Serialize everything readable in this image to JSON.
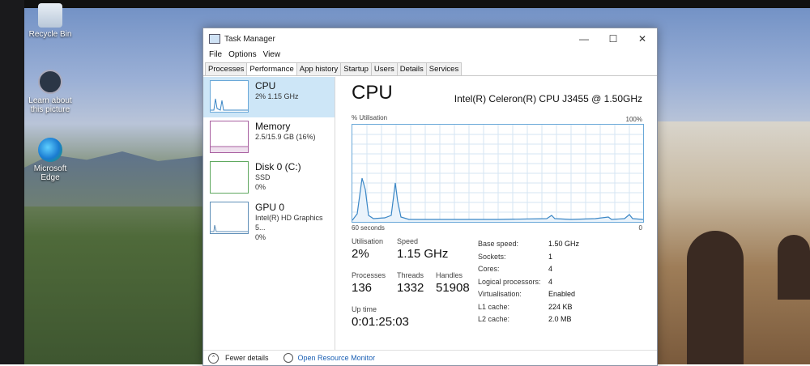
{
  "desktop": {
    "icons": [
      {
        "label": "Recycle Bin"
      },
      {
        "label": "Learn about this picture"
      },
      {
        "label": "Microsoft Edge"
      }
    ]
  },
  "window": {
    "title": "Task Manager",
    "menu": [
      "File",
      "Options",
      "View"
    ],
    "tabs": [
      "Processes",
      "Performance",
      "App history",
      "Startup",
      "Users",
      "Details",
      "Services"
    ],
    "active_tab": "Performance"
  },
  "sidebar": {
    "items": [
      {
        "name": "CPU",
        "sub": "2%  1.15 GHz",
        "sub2": ""
      },
      {
        "name": "Memory",
        "sub": "2.5/15.9 GB (16%)",
        "sub2": ""
      },
      {
        "name": "Disk 0 (C:)",
        "sub": "SSD",
        "sub2": "0%"
      },
      {
        "name": "GPU 0",
        "sub": "Intel(R) HD Graphics 5...",
        "sub2": "0%"
      }
    ]
  },
  "main": {
    "title": "CPU",
    "model": "Intel(R) Celeron(R) CPU J3455 @ 1.50GHz",
    "graph": {
      "y_label": "% Utilisation",
      "y_max_label": "100%",
      "x_left_label": "60 seconds",
      "x_right_label": "0"
    },
    "stats": {
      "utilisation_label": "Utilisation",
      "utilisation": "2%",
      "speed_label": "Speed",
      "speed": "1.15 GHz",
      "processes_label": "Processes",
      "processes": "136",
      "threads_label": "Threads",
      "threads": "1332",
      "handles_label": "Handles",
      "handles": "51908",
      "uptime_label": "Up time",
      "uptime": "0:01:25:03"
    },
    "details": [
      {
        "k": "Base speed:",
        "v": "1.50 GHz"
      },
      {
        "k": "Sockets:",
        "v": "1"
      },
      {
        "k": "Cores:",
        "v": "4"
      },
      {
        "k": "Logical processors:",
        "v": "4"
      },
      {
        "k": "Virtualisation:",
        "v": "Enabled"
      },
      {
        "k": "L1 cache:",
        "v": "224 KB"
      },
      {
        "k": "L2 cache:",
        "v": "2.0 MB"
      }
    ]
  },
  "footer": {
    "fewer_details": "Fewer details",
    "open_monitor": "Open Resource Monitor"
  }
}
